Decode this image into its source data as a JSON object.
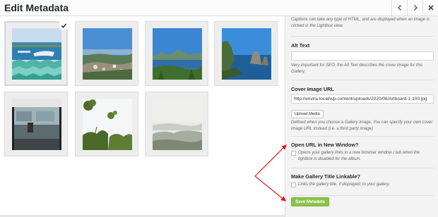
{
  "header": {
    "title": "Edit Metadata",
    "prev_icon": "chevron-left-icon",
    "next_icon": "chevron-right-icon",
    "close_icon": "close-icon"
  },
  "gallery": {
    "images": [
      {
        "name": "harbor-image",
        "selected": true
      },
      {
        "name": "coastal-town-image",
        "selected": false
      },
      {
        "name": "mountain-sea-image",
        "selected": false
      },
      {
        "name": "sea-cliffs-image",
        "selected": false
      },
      {
        "name": "boat-window-image",
        "selected": false
      },
      {
        "name": "trees-sky-image",
        "selected": false
      },
      {
        "name": "hazy-landscape-image",
        "selected": false
      }
    ]
  },
  "sidebar": {
    "caption_help": "Captions can take any type of HTML, and are displayed when an image is clicked in the Lightbox view.",
    "alt_text": {
      "label": "Alt Text",
      "value": "",
      "help": "Very important for SEO, the Alt Text describes the cover image for this Gallery."
    },
    "cover_image_url": {
      "label": "Cover Image URL",
      "value": "http://envira.local/wp-content/uploads/2020/06/Artboard-1-100.jpg",
      "upload_label": "Upload Media",
      "help": "Defined when you choose a Gallery image. You can specify your own cover image URL instead (i.e. a third party image)"
    },
    "open_new_window": {
      "label": "Open URL in New Window?",
      "help": "Opens your gallery links in a new browser window / tab when the lightbox is disabled for the album.",
      "checked": false
    },
    "title_linkable": {
      "label": "Make Gallery Title Linkable?",
      "help": "Links the gallery title, if displayed, to your gallery.",
      "checked": false
    },
    "save_label": "Save Metadata"
  },
  "colors": {
    "accent_green": "#8bc34a",
    "arrow_red": "#e0161e"
  }
}
